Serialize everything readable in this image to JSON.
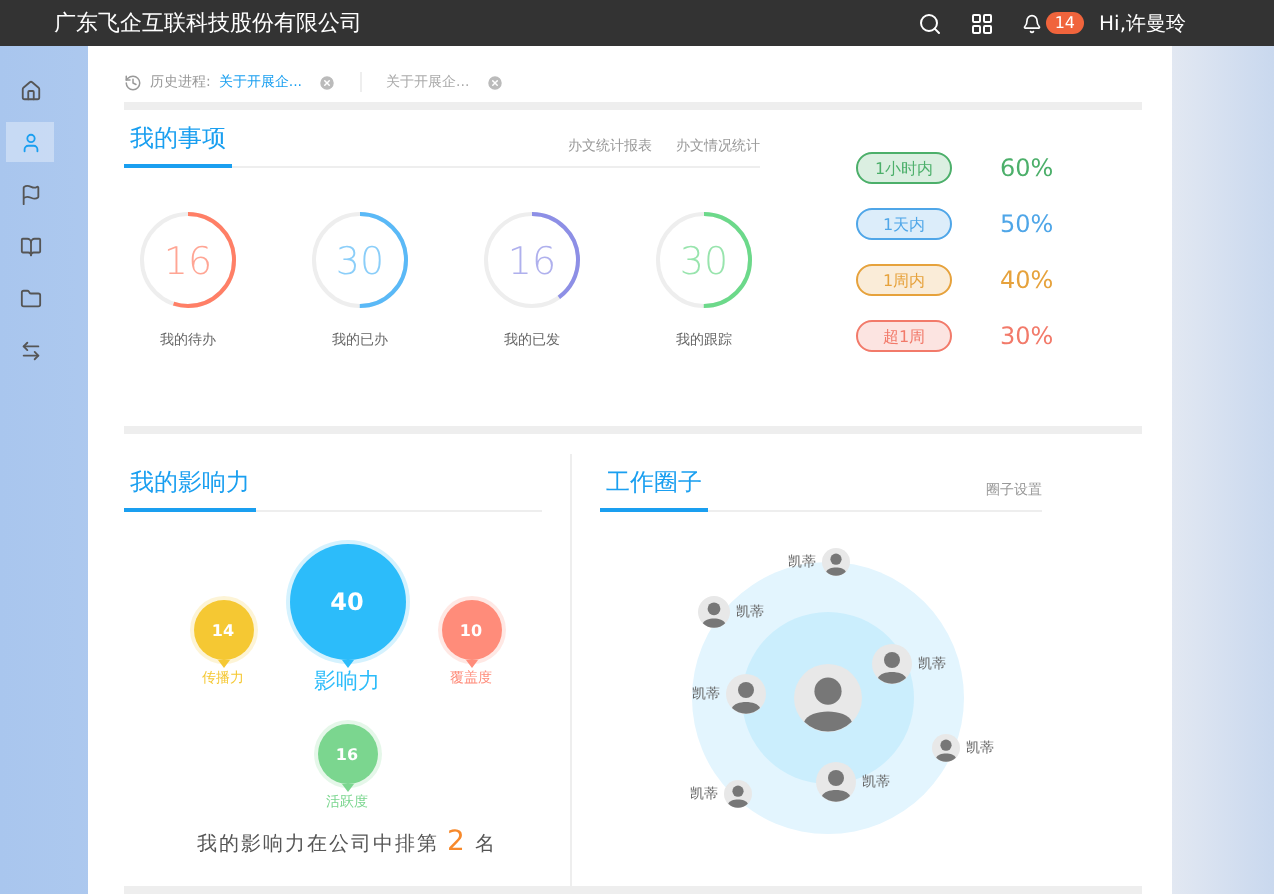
{
  "header": {
    "company": "广东飞企互联科技股份有限公司",
    "notification_count": "14",
    "greeting": "Hi,许曼玲"
  },
  "sidebar": {
    "items": [
      {
        "kind": "home",
        "selected": false
      },
      {
        "kind": "user",
        "selected": true
      },
      {
        "kind": "flag",
        "selected": false
      },
      {
        "kind": "book",
        "selected": false
      },
      {
        "kind": "folder",
        "selected": false
      },
      {
        "kind": "swap",
        "selected": false
      }
    ]
  },
  "history": {
    "label": "历史进程:",
    "items": [
      {
        "label": "关于开展企...",
        "selected": true
      },
      {
        "label": "关于开展企...",
        "selected": false
      }
    ]
  },
  "my_items": {
    "title": "我的事项",
    "links": [
      "办文统计报表",
      "办文情况统计"
    ],
    "counters": [
      {
        "value": "16",
        "label": "我的待办",
        "color": "#ff7f66",
        "level": 0.55
      },
      {
        "value": "30",
        "label": "我的已办",
        "color": "#5ab9f7",
        "level": 0.5
      },
      {
        "value": "16",
        "label": "我的已发",
        "color": "#8d8fe6",
        "level": 0.4
      },
      {
        "value": "30",
        "label": "我的跟踪",
        "color": "#6cd98a",
        "level": 0.5
      }
    ]
  },
  "legend": [
    {
      "label": "1小时内",
      "value": "60%",
      "color": "#4caf6a"
    },
    {
      "label": "1天内",
      "value": "50%",
      "color": "#4fa6e8"
    },
    {
      "label": "1周内",
      "value": "40%",
      "color": "#e6a23c"
    },
    {
      "label": "超1周",
      "value": "30%",
      "color": "#f27a6a"
    }
  ],
  "influence": {
    "title": "我的影响力",
    "bubbles": [
      {
        "kind": "side",
        "value": "14",
        "label": "传播力",
        "color": "#f5c833"
      },
      {
        "kind": "main",
        "value": "40",
        "label": "影响力",
        "color": "#2cbcfa"
      },
      {
        "kind": "side",
        "value": "10",
        "label": "覆盖度",
        "color": "#ff8c7a"
      },
      {
        "kind": "bottom",
        "value": "16",
        "label": "活跃度",
        "color": "#7bd68f"
      }
    ],
    "rank": {
      "prefix": "我的影响力在公司中排第",
      "value": "2",
      "suffix": "名"
    }
  },
  "work_circle": {
    "title": "工作圈子",
    "link": "圈子设置",
    "members": [
      {
        "name": "凯蒂"
      },
      {
        "name": "凯蒂"
      },
      {
        "name": "凯蒂"
      },
      {
        "name": "凯蒂"
      },
      {
        "name": "凯蒂"
      },
      {
        "name": "凯蒂"
      },
      {
        "name": "凯蒂"
      }
    ]
  }
}
